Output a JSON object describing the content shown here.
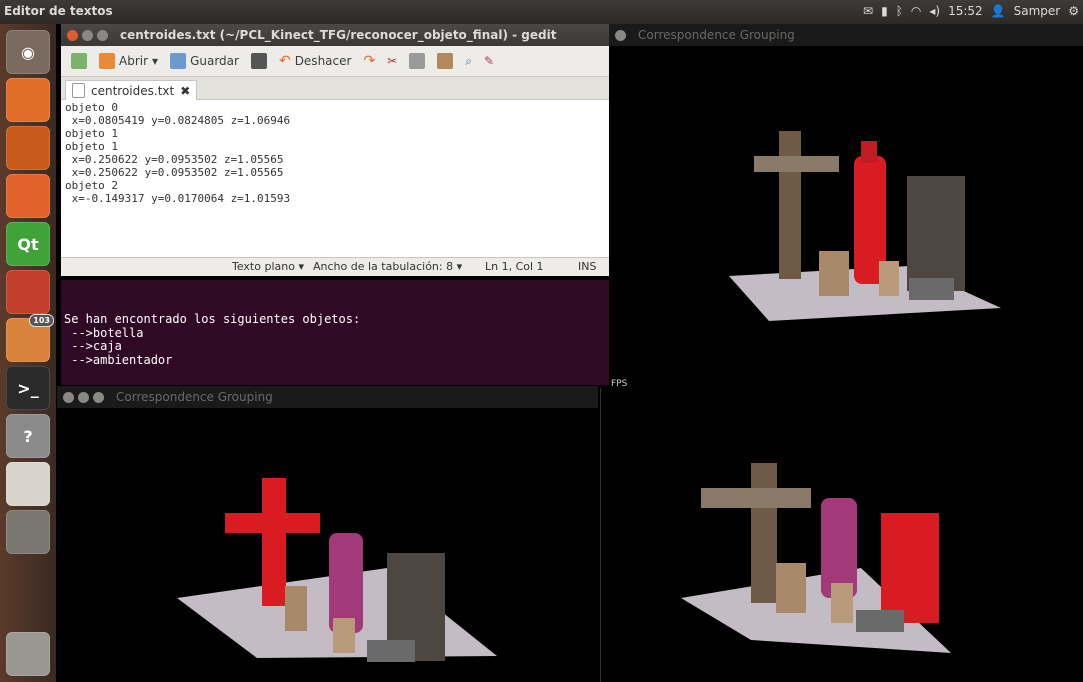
{
  "topbar": {
    "app_name": "Editor de textos",
    "time": "15:52",
    "user": "Samper"
  },
  "launcher": {
    "items": [
      {
        "name": "dash",
        "glyph": "◉",
        "color": "#7a6a60"
      },
      {
        "name": "files",
        "glyph": "",
        "color": "#e26d2b"
      },
      {
        "name": "firefox",
        "glyph": "",
        "color": "#c85a1a"
      },
      {
        "name": "software",
        "glyph": "",
        "color": "#e2622b"
      },
      {
        "name": "qt",
        "glyph": "Qt",
        "color": "#3fa33a"
      },
      {
        "name": "settings",
        "glyph": "",
        "color": "#c2402a"
      },
      {
        "name": "updates",
        "glyph": "",
        "color": "#d8823a",
        "badge": "103"
      },
      {
        "name": "terminal",
        "glyph": ">_",
        "color": "#2a2a2a"
      },
      {
        "name": "help",
        "glyph": "?",
        "color": "#8a8a8a"
      },
      {
        "name": "gedit",
        "glyph": "",
        "color": "#d8d4cc"
      },
      {
        "name": "window",
        "glyph": "",
        "color": "#7a7670"
      }
    ],
    "trash": {
      "name": "trash",
      "glyph": "",
      "color": "#9a9690"
    }
  },
  "gedit": {
    "title": "centroides.txt (~/PCL_Kinect_TFG/reconocer_objeto_final) - gedit",
    "toolbar": {
      "open_label": "Abrir",
      "save_label": "Guardar",
      "undo_label": "Deshacer"
    },
    "tab_label": "centroides.txt",
    "content": "objeto 0\n x=0.0805419 y=0.0824805 z=1.06946\nobjeto 1\nobjeto 1\n x=0.250622 y=0.0953502 z=1.05565\n x=0.250622 y=0.0953502 z=1.05565\nobjeto 2\n x=-0.149317 y=0.0170064 z=1.01593",
    "status": {
      "language": "Texto plano ▾",
      "tab_width": "Ancho de la tabulación: 8 ▾",
      "position": "Ln 1, Col 1",
      "mode": "INS"
    }
  },
  "terminal": {
    "content": "Se han encontrado los siguientes objetos:\n -->botella\n -->caja\n -->ambientador\n\n\nSeleccione uno de ellos:"
  },
  "viewers": {
    "top_right_title": "Correspondence Grouping",
    "bottom_left_title": "Correspondence Grouping",
    "fps_label": "FPS"
  },
  "colors": {
    "terminal_bg": "#300a24",
    "highlight_red": "#d81c22",
    "cloud_white": "#e6dde6"
  }
}
